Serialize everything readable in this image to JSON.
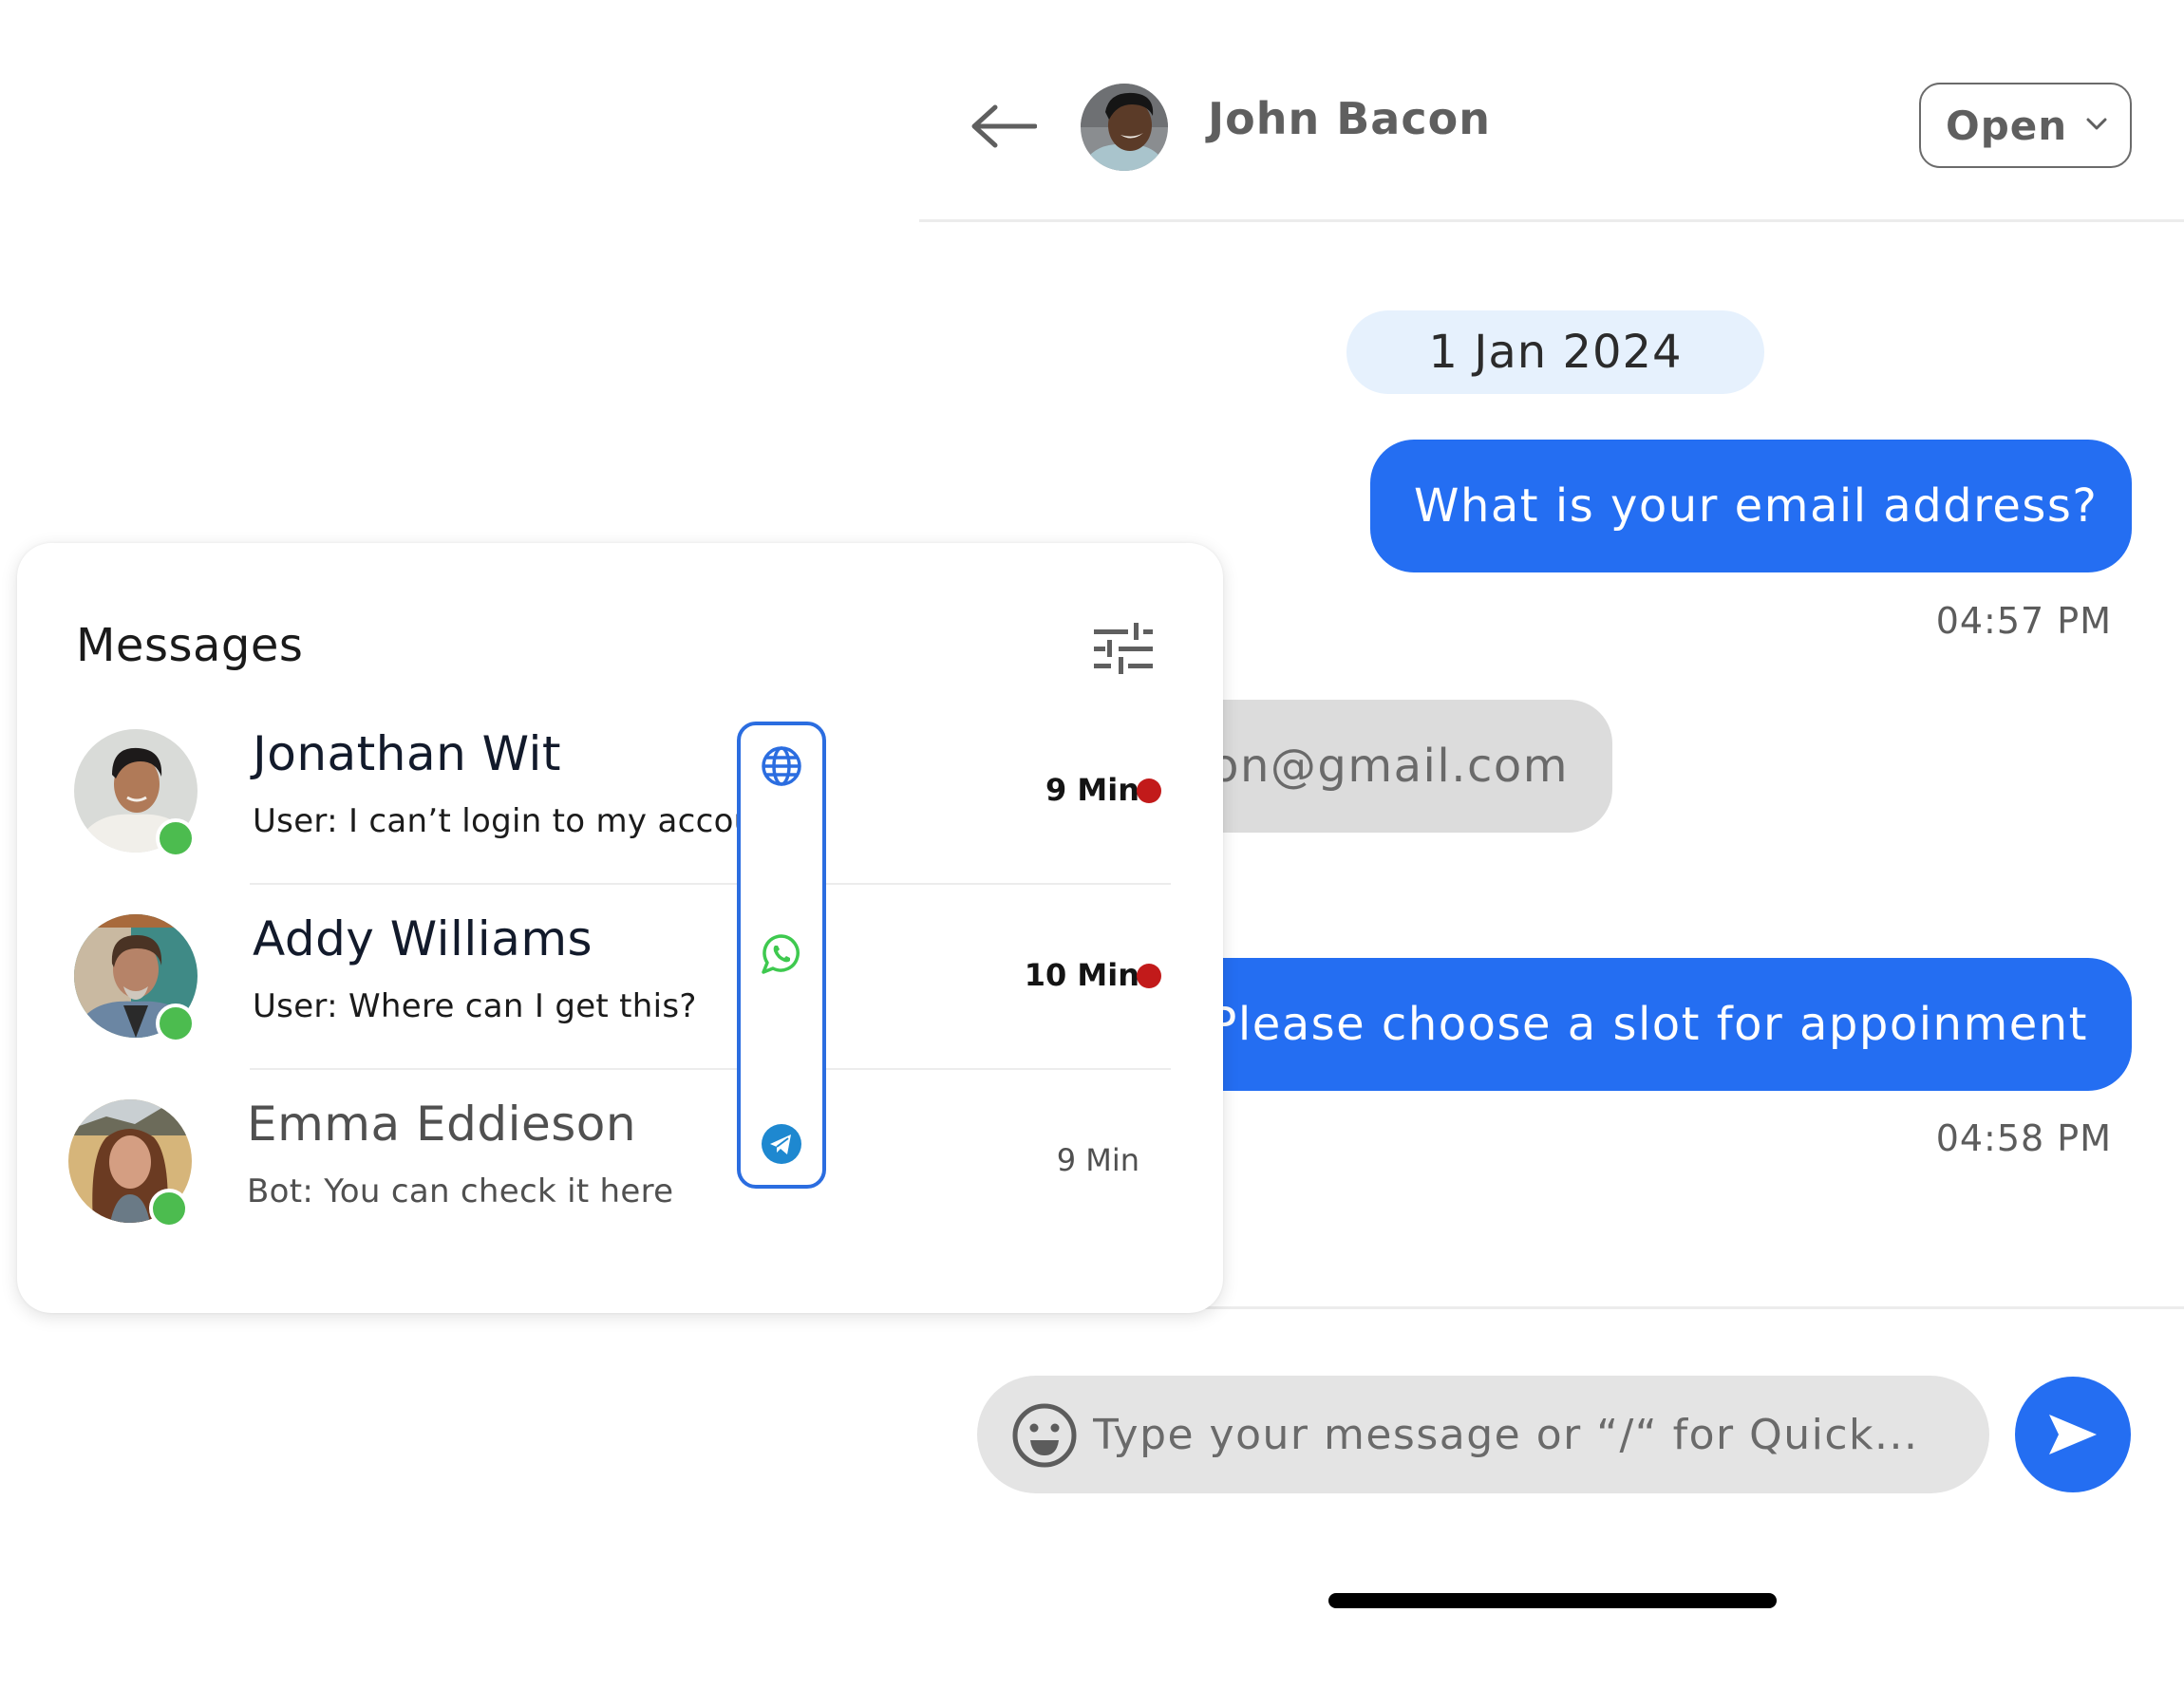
{
  "header": {
    "back_icon": "arrow-left-icon",
    "contact_name": "John Bacon",
    "status": {
      "selected": "Open",
      "icon": "chevron-down-icon"
    }
  },
  "conversation": {
    "date_separator": "1 Jan 2024",
    "messages": [
      {
        "direction": "outgoing",
        "text": "What is your email address?",
        "time": "04:57 PM"
      },
      {
        "direction": "incoming",
        "text": "on@gmail.com"
      },
      {
        "direction": "outgoing",
        "text": "Please choose a slot for appoinment",
        "time": "04:58 PM"
      }
    ]
  },
  "composer": {
    "emoji_icon": "smiley-icon",
    "placeholder": "Type your message or “/“ for Quick...",
    "value": "",
    "send_icon": "send-icon"
  },
  "panel": {
    "title": "Messages",
    "filter_icon": "sliders-icon",
    "conversations": [
      {
        "name": "Jonathan Wit",
        "preview": "User: I can’t login to my account",
        "time": "9 Min",
        "unread": true,
        "online": true
      },
      {
        "name": "Addy Williams",
        "preview": "User: Where can I get this?",
        "time": "10 Min",
        "unread": true,
        "online": true
      },
      {
        "name": "Emma Eddieson",
        "preview": "Bot: You can check it here",
        "time": "9 Min",
        "unread": false,
        "online": true
      }
    ],
    "channels": [
      {
        "name": "Web",
        "icon": "globe-icon",
        "color": "#2b6de0"
      },
      {
        "name": "WhatsApp",
        "icon": "whatsapp-icon",
        "color": "#3ec94f"
      },
      {
        "name": "Telegram",
        "icon": "telegram-icon",
        "color": "#1e88d0"
      }
    ]
  },
  "colors": {
    "accent": "#246ef2",
    "incoming_bubble": "#dcdcdc",
    "date_pill": "#e6f1fd",
    "online": "#4cbc4f",
    "unread": "#c21a1a"
  }
}
